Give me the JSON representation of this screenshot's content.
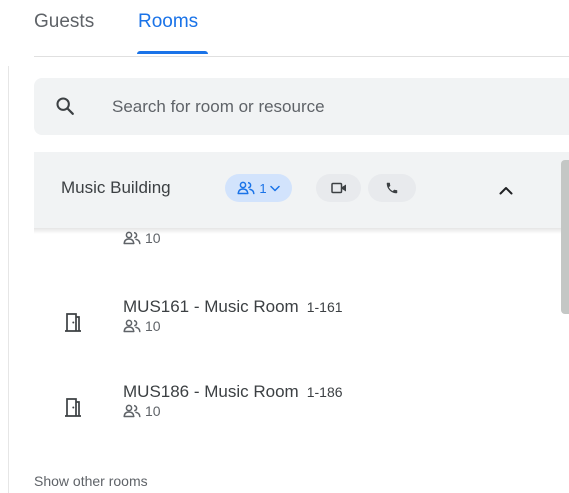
{
  "tabs": [
    {
      "label": "Guests",
      "active": false
    },
    {
      "label": "Rooms",
      "active": true
    }
  ],
  "search": {
    "placeholder": "Search for room or resource",
    "value": "",
    "icon": "search-icon"
  },
  "building": {
    "name": "Music Building",
    "capacity_filter": "1",
    "icons": [
      "people-icon",
      "chevron-down-icon",
      "video-camera-icon",
      "phone-icon",
      "chevron-up-icon"
    ]
  },
  "rooms": [
    {
      "title": "",
      "code": "",
      "capacity": "10",
      "partial": true
    },
    {
      "title": "MUS161 - Music Room",
      "code": "1-161",
      "capacity": "10"
    },
    {
      "title": "MUS186 - Music Room",
      "code": "1-186",
      "capacity": "10"
    }
  ],
  "footer": {
    "show_other": "Show other rooms"
  },
  "colors": {
    "accent": "#1a73e8",
    "chip_bg": "#d2e3fc",
    "panel_bg": "#f1f3f4",
    "text": "#3c4043",
    "muted": "#5f6368"
  }
}
